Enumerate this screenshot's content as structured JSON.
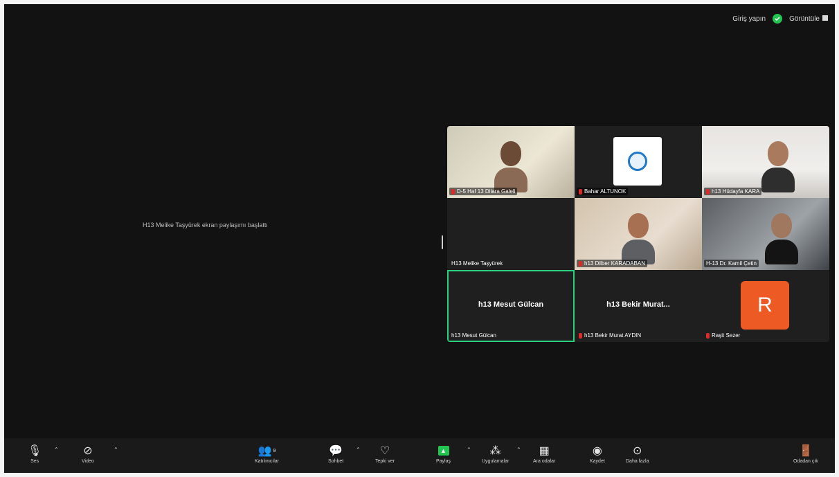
{
  "topbar": {
    "signin": "Giriş yapın",
    "view": "Görüntüle"
  },
  "share_message": "H13 Melike Taşyürek ekran paylaşımı başlattı",
  "tiles": [
    {
      "name": "D-5 Haf 13 Dilara Galeli",
      "muted": true
    },
    {
      "name": "Bahar ALTUNOK",
      "muted": true
    },
    {
      "name": "h13 Hüdayfa KARA",
      "muted": true
    },
    {
      "name": "H13 Melike Taşyürek",
      "muted": false
    },
    {
      "name": "h13 Dilber KARADABAN",
      "muted": true
    },
    {
      "name": "H-13 Dr. Kamil Çetin",
      "muted": false
    },
    {
      "name": "h13 Mesut Gülcan",
      "center": "h13 Mesut Gülcan",
      "muted": false
    },
    {
      "name": "h13 Bekir Murat AYDIN",
      "center": "h13 Bekir Murat...",
      "muted": true
    },
    {
      "name": "Raşit Sezer",
      "avatar": "R",
      "muted": true
    }
  ],
  "toolbar": {
    "audio": "Ses",
    "video": "Video",
    "participants": "Katılımcılar",
    "participants_count": "9",
    "chat": "Sohbet",
    "react": "Tepki ver",
    "share": "Paylaş",
    "apps": "Uygulamalar",
    "breakout": "Ara odalar",
    "record": "Kaydet",
    "more": "Daha fazla",
    "leave": "Odadan çık"
  },
  "colors": {
    "accent": "#23c552",
    "active_border": "#2bd17e",
    "avatar": "#ee5a24"
  }
}
